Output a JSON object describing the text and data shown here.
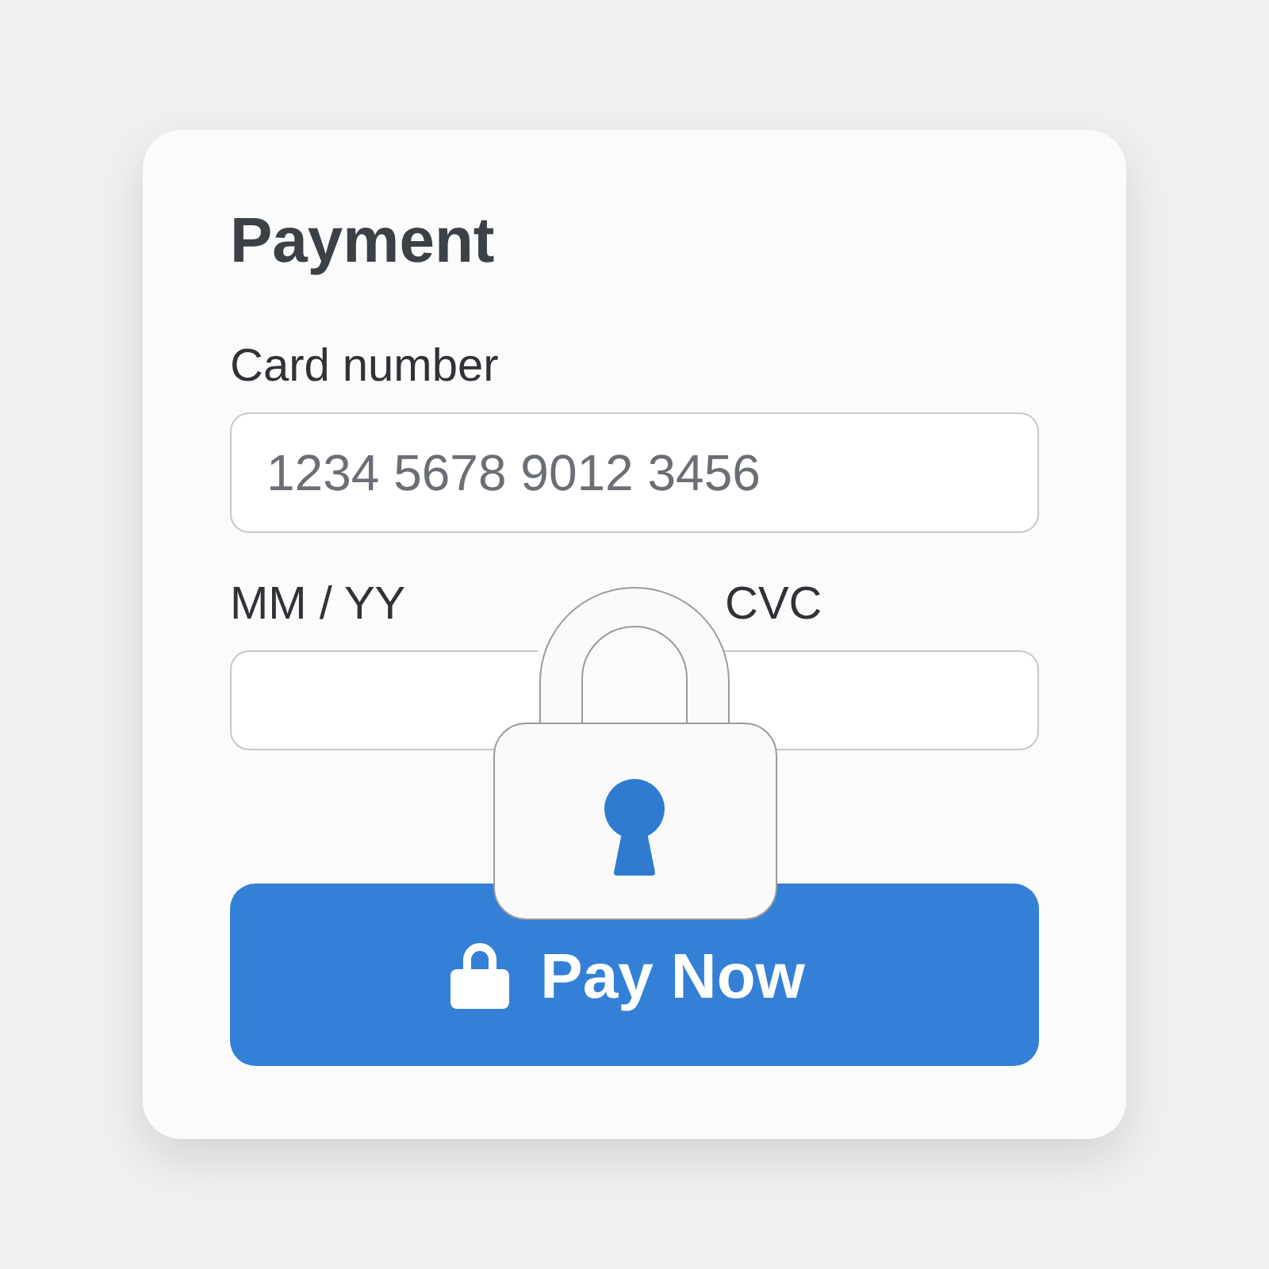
{
  "card": {
    "title": "Payment"
  },
  "card_number": {
    "label": "Card number",
    "placeholder": "1234 5678 9012 3456"
  },
  "expiry": {
    "label": "MM / YY"
  },
  "cvc": {
    "label": "CVC"
  },
  "pay_button": {
    "label": "Pay Now"
  }
}
